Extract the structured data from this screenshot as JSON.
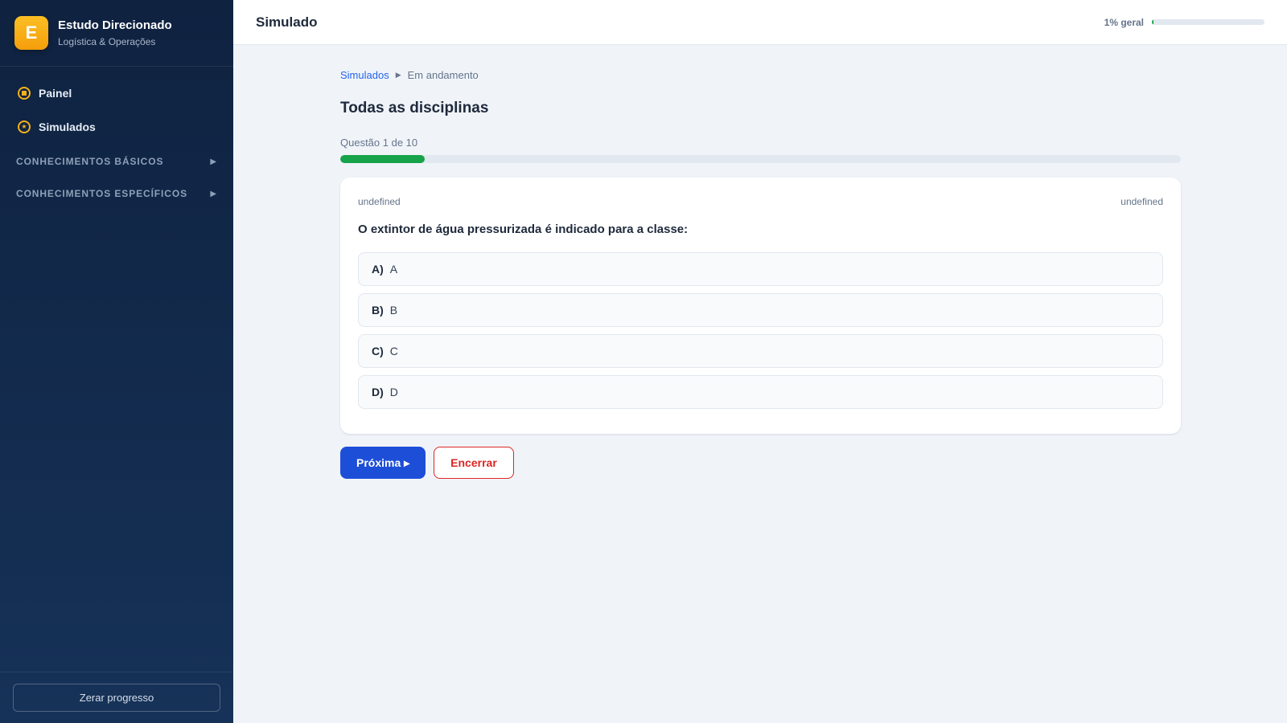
{
  "brand": {
    "logo_letter": "E",
    "title": "Estudo Direcionado",
    "subtitle": "Logística & Operações"
  },
  "sidebar": {
    "items": [
      {
        "label": "Painel",
        "icon": "dashboard-icon"
      },
      {
        "label": "Simulados",
        "icon": "star-icon"
      }
    ],
    "sections": [
      {
        "label": "CONHECIMENTOS BÁSICOS"
      },
      {
        "label": "CONHECIMENTOS ESPECÍFICOS"
      }
    ],
    "reset_label": "Zerar progresso"
  },
  "topbar": {
    "title": "Simulado",
    "overall_label": "1% geral",
    "overall_progress": 0.01
  },
  "breadcrumb": {
    "link": "Simulados",
    "current": "Em andamento"
  },
  "page_title": "Todas as disciplinas",
  "quiz": {
    "counter": "Questão 1 de 10",
    "progress": 0.1,
    "meta_left": "undefined",
    "meta_right": "undefined",
    "question": "O extintor de água pressurizada é indicado para a classe:",
    "options": [
      {
        "letter": "A)",
        "text": "A"
      },
      {
        "letter": "B)",
        "text": "B"
      },
      {
        "letter": "C)",
        "text": "C"
      },
      {
        "letter": "D)",
        "text": "D"
      }
    ]
  },
  "actions": {
    "next_label": "Próxima ▸",
    "end_label": "Encerrar"
  },
  "colors": {
    "accent": "#1d4ed8",
    "brand": "#f59e0b",
    "progress": "#16a34a",
    "danger": "#dc2626",
    "sidebar_bg": "#0f2240"
  }
}
